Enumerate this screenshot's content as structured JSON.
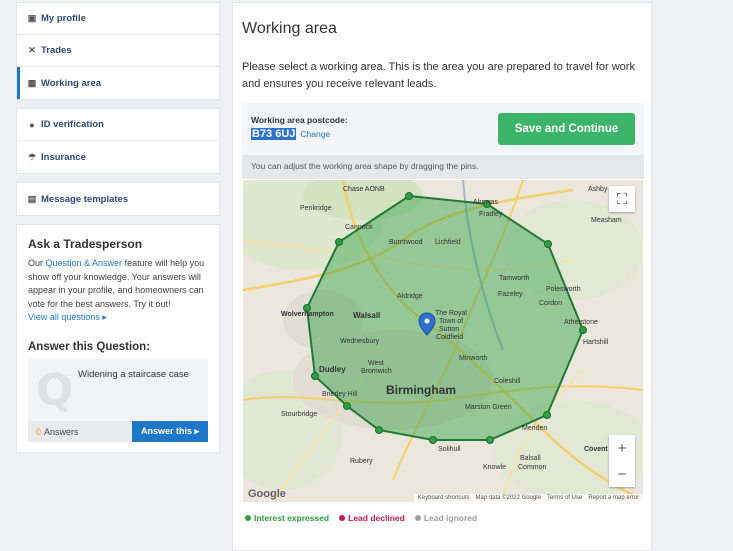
{
  "sidebar": {
    "group1": [
      {
        "label": "My profile",
        "icon": "id-card-icon",
        "glyph": "▣"
      },
      {
        "label": "Trades",
        "icon": "tools-icon",
        "glyph": "✕"
      },
      {
        "label": "Working area",
        "icon": "map-icon",
        "glyph": "▦"
      }
    ],
    "group2": [
      {
        "label": "ID verification",
        "icon": "user-icon",
        "glyph": "●"
      },
      {
        "label": "Insurance",
        "icon": "umbrella-icon",
        "glyph": "☂"
      }
    ],
    "group3": [
      {
        "label": "Message templates",
        "icon": "document-icon",
        "glyph": "▤"
      }
    ],
    "ask": {
      "title": "Ask a Tradesperson",
      "text_before": "Our ",
      "link": "Question & Answer",
      "text_after": " feature will help you show off your knowledge. Your answers will appear in your profile, and homeowners can vote for the best answers. Try it out!",
      "view_all": "View all questions ▸",
      "answer_title": "Answer this Question:",
      "question": "Widening a staircase case",
      "answers_count": "0",
      "answers_label": "Answers",
      "answer_button": "Answer this ▸"
    }
  },
  "main": {
    "title": "Working area",
    "description": "Please select a working area. This is the area you are prepared to travel for work and ensures you receive relevant leads.",
    "postcode_label": "Working area postcode:",
    "postcode_value": "B73 6UJ",
    "change_label": "Change",
    "save_button": "Save and Continue",
    "hint": "You can adjust the working area shape by dragging the pins.",
    "map": {
      "labels": {
        "chase": "Chase AONB",
        "cannock": "Cannock",
        "penkridge": "Penkridge",
        "burntwood": "Burntwood",
        "lichfield": "Lichfield",
        "alrewas": "Alrewas",
        "fradley": "Fradley",
        "ashby": "Ashby de la Z",
        "measham": "Measham",
        "tamworth": "Tamworth",
        "polesworth": "Polesworth",
        "fazeley": "Fazeley",
        "cordon": "Cordon",
        "aldridge": "Aldridge",
        "walsall": "Walsall",
        "wolverhampton": "Wolverhampton",
        "wednesbury": "Wednesbury",
        "royal": "The Royal",
        "town": "Town of",
        "sutton": "Sutton",
        "coldfield": "Coldfield",
        "minworth": "Minworth",
        "atherstone": "Atherstone",
        "hartshill": "Hartshill",
        "dudley": "Dudley",
        "westbrom1": "West",
        "westbrom2": "Bromwich",
        "birmingham": "Birmingham",
        "coleshill": "Coleshill",
        "brierley": "Brierley Hill",
        "stourbridge": "Stourbridge",
        "marston": "Marston Green",
        "meriden": "Meriden",
        "coventry": "Covent",
        "rubery": "Rubery",
        "solihull": "Solihull",
        "knowle": "Knowle",
        "balsall1": "Balsall",
        "balsall2": "Common",
        "cannockchase": "Cannock"
      },
      "zoom_in": "+",
      "zoom_out": "−",
      "fullscreen": "⛶",
      "google": "Google",
      "footer": [
        "Keyboard shortcuts",
        "Map data ©2022 Google",
        "Terms of Use",
        "Report a map error"
      ]
    },
    "legend": [
      {
        "label": "Interest expressed",
        "color": "#2ea043"
      },
      {
        "label": "Lead declined",
        "color": "#c2185b"
      },
      {
        "label": "Lead ignored",
        "color": "#9e9e9e"
      }
    ]
  }
}
